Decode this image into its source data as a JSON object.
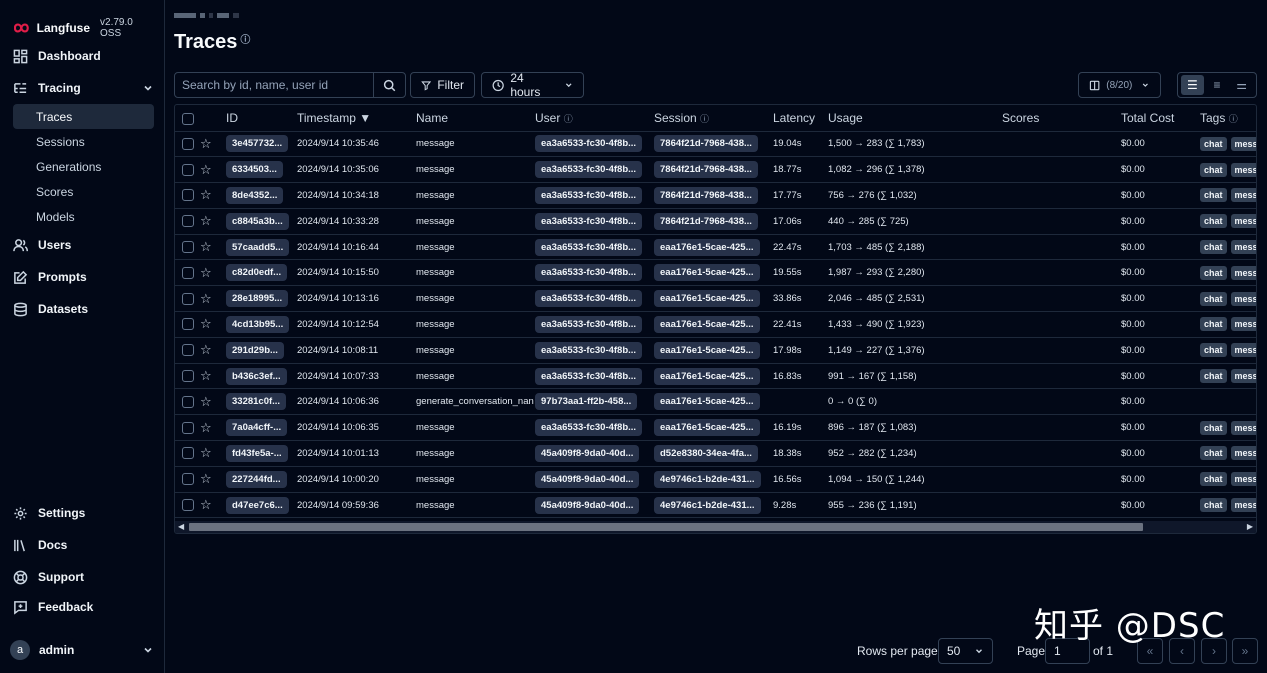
{
  "app": {
    "name": "Langfuse",
    "version": "v2.79.0 OSS"
  },
  "sidebar": {
    "dashboard": "Dashboard",
    "tracing": "Tracing",
    "tracing_items": [
      "Traces",
      "Sessions",
      "Generations",
      "Scores",
      "Models"
    ],
    "users": "Users",
    "prompts": "Prompts",
    "datasets": "Datasets",
    "settings": "Settings",
    "docs": "Docs",
    "support": "Support",
    "feedback": "Feedback",
    "user_initial": "a",
    "user_name": "admin"
  },
  "page": {
    "title": "Traces"
  },
  "toolbar": {
    "search_placeholder": "Search by id, name, user id",
    "filter_label": "Filter",
    "time_range": "24 hours",
    "columns_label": "(8/20)"
  },
  "table": {
    "headers": {
      "id": "ID",
      "timestamp": "Timestamp ▼",
      "name": "Name",
      "user": "User",
      "session": "Session",
      "latency": "Latency",
      "usage": "Usage",
      "scores": "Scores",
      "total_cost": "Total Cost",
      "tags": "Tags"
    },
    "rows": [
      {
        "id": "3e457732...",
        "timestamp": "2024/9/14 10:35:46",
        "name": "message",
        "user": "ea3a6533-fc30-4f8b...",
        "session": "7864f21d-7968-438...",
        "latency": "19.04s",
        "usage": "1,500 → 283 (∑ 1,783)",
        "cost": "$0.00",
        "tags": [
          "chat",
          "mess"
        ]
      },
      {
        "id": "6334503...",
        "timestamp": "2024/9/14 10:35:06",
        "name": "message",
        "user": "ea3a6533-fc30-4f8b...",
        "session": "7864f21d-7968-438...",
        "latency": "18.77s",
        "usage": "1,082 → 296 (∑ 1,378)",
        "cost": "$0.00",
        "tags": [
          "chat",
          "mess"
        ]
      },
      {
        "id": "8de4352...",
        "timestamp": "2024/9/14 10:34:18",
        "name": "message",
        "user": "ea3a6533-fc30-4f8b...",
        "session": "7864f21d-7968-438...",
        "latency": "17.77s",
        "usage": "756 → 276 (∑ 1,032)",
        "cost": "$0.00",
        "tags": [
          "chat",
          "mess"
        ]
      },
      {
        "id": "c8845a3b...",
        "timestamp": "2024/9/14 10:33:28",
        "name": "message",
        "user": "ea3a6533-fc30-4f8b...",
        "session": "7864f21d-7968-438...",
        "latency": "17.06s",
        "usage": "440 → 285 (∑ 725)",
        "cost": "$0.00",
        "tags": [
          "chat",
          "mess"
        ]
      },
      {
        "id": "57caadd5...",
        "timestamp": "2024/9/14 10:16:44",
        "name": "message",
        "user": "ea3a6533-fc30-4f8b...",
        "session": "eaa176e1-5cae-425...",
        "latency": "22.47s",
        "usage": "1,703 → 485 (∑ 2,188)",
        "cost": "$0.00",
        "tags": [
          "chat",
          "mess"
        ]
      },
      {
        "id": "c82d0edf...",
        "timestamp": "2024/9/14 10:15:50",
        "name": "message",
        "user": "ea3a6533-fc30-4f8b...",
        "session": "eaa176e1-5cae-425...",
        "latency": "19.55s",
        "usage": "1,987 → 293 (∑ 2,280)",
        "cost": "$0.00",
        "tags": [
          "chat",
          "mess"
        ]
      },
      {
        "id": "28e18995...",
        "timestamp": "2024/9/14 10:13:16",
        "name": "message",
        "user": "ea3a6533-fc30-4f8b...",
        "session": "eaa176e1-5cae-425...",
        "latency": "33.86s",
        "usage": "2,046 → 485 (∑ 2,531)",
        "cost": "$0.00",
        "tags": [
          "chat",
          "mess"
        ]
      },
      {
        "id": "4cd13b95...",
        "timestamp": "2024/9/14 10:12:54",
        "name": "message",
        "user": "ea3a6533-fc30-4f8b...",
        "session": "eaa176e1-5cae-425...",
        "latency": "22.41s",
        "usage": "1,433 → 490 (∑ 1,923)",
        "cost": "$0.00",
        "tags": [
          "chat",
          "mess"
        ]
      },
      {
        "id": "291d29b...",
        "timestamp": "2024/9/14 10:08:11",
        "name": "message",
        "user": "ea3a6533-fc30-4f8b...",
        "session": "eaa176e1-5cae-425...",
        "latency": "17.98s",
        "usage": "1,149 → 227 (∑ 1,376)",
        "cost": "$0.00",
        "tags": [
          "chat",
          "mess"
        ]
      },
      {
        "id": "b436c3ef...",
        "timestamp": "2024/9/14 10:07:33",
        "name": "message",
        "user": "ea3a6533-fc30-4f8b...",
        "session": "eaa176e1-5cae-425...",
        "latency": "16.83s",
        "usage": "991 → 167 (∑ 1,158)",
        "cost": "$0.00",
        "tags": [
          "chat",
          "mess"
        ]
      },
      {
        "id": "33281c0f...",
        "timestamp": "2024/9/14 10:06:36",
        "name": "generate_conversation_nan",
        "user": "97b73aa1-ff2b-458...",
        "session": "eaa176e1-5cae-425...",
        "latency": "",
        "usage": "0 → 0 (∑ 0)",
        "cost": "$0.00",
        "tags": []
      },
      {
        "id": "7a0a4cff-...",
        "timestamp": "2024/9/14 10:06:35",
        "name": "message",
        "user": "ea3a6533-fc30-4f8b...",
        "session": "eaa176e1-5cae-425...",
        "latency": "16.19s",
        "usage": "896 → 187 (∑ 1,083)",
        "cost": "$0.00",
        "tags": [
          "chat",
          "mess"
        ]
      },
      {
        "id": "fd43fe5a-...",
        "timestamp": "2024/9/14 10:01:13",
        "name": "message",
        "user": "45a409f8-9da0-40d...",
        "session": "d52e8380-34ea-4fa...",
        "latency": "18.38s",
        "usage": "952 → 282 (∑ 1,234)",
        "cost": "$0.00",
        "tags": [
          "chat",
          "mess"
        ]
      },
      {
        "id": "227244fd...",
        "timestamp": "2024/9/14 10:00:20",
        "name": "message",
        "user": "45a409f8-9da0-40d...",
        "session": "4e9746c1-b2de-431...",
        "latency": "16.56s",
        "usage": "1,094 → 150 (∑ 1,244)",
        "cost": "$0.00",
        "tags": [
          "chat",
          "mess"
        ]
      },
      {
        "id": "d47ee7c6...",
        "timestamp": "2024/9/14 09:59:36",
        "name": "message",
        "user": "45a409f8-9da0-40d...",
        "session": "4e9746c1-b2de-431...",
        "latency": "9.28s",
        "usage": "955 → 236 (∑ 1,191)",
        "cost": "$0.00",
        "tags": [
          "chat",
          "mess"
        ]
      }
    ]
  },
  "pagination": {
    "rows_per_page_label": "Rows per page",
    "rows_per_page": "50",
    "page_label": "Page",
    "page_value": "1",
    "of_label": "of 1"
  },
  "watermark": "知乎 @DSC",
  "colors": {
    "background": "#020817",
    "border": "#1e293b",
    "pill": "#27324a",
    "brand": "#e11d48"
  }
}
